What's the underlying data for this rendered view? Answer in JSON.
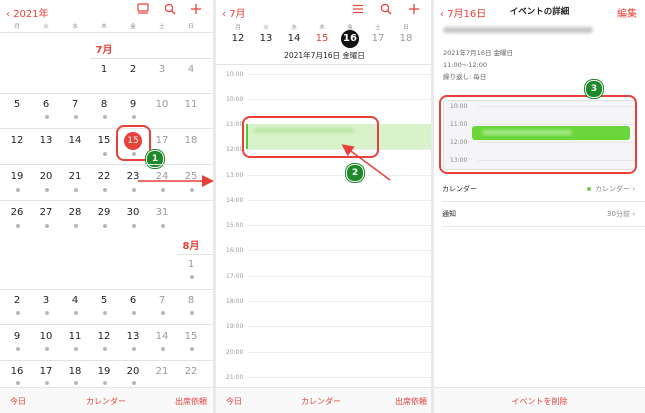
{
  "panel1": {
    "back_label": "2021年",
    "weekdays": [
      "月",
      "火",
      "水",
      "木",
      "金",
      "土",
      "日"
    ],
    "month_july": "7月",
    "month_aug": "8月",
    "days": {
      "r1": [
        "1",
        "2",
        "3",
        "4"
      ],
      "r2": [
        "5",
        "6",
        "7",
        "8",
        "9",
        "10",
        "11"
      ],
      "r3": [
        "12",
        "13",
        "14",
        "15",
        "15",
        "17",
        "18"
      ],
      "r4": [
        "19",
        "20",
        "21",
        "22",
        "23",
        "24",
        "25"
      ],
      "r5": [
        "26",
        "27",
        "28",
        "29",
        "30",
        "31"
      ],
      "a1": [
        "1"
      ],
      "a2": [
        "2",
        "3",
        "4",
        "5",
        "6",
        "7",
        "8"
      ],
      "a3": [
        "9",
        "10",
        "11",
        "12",
        "13",
        "14",
        "15"
      ],
      "a4": [
        "16",
        "17",
        "18",
        "19",
        "20",
        "21",
        "22"
      ]
    },
    "bottom": {
      "today": "今日",
      "calendar": "カレンダー",
      "invites": "出席依頼"
    }
  },
  "panel2": {
    "back_label": "7月",
    "weekdays": [
      "月",
      "火",
      "水",
      "木",
      "金",
      "土",
      "日"
    ],
    "week_days": [
      "12",
      "13",
      "14",
      "15",
      "16",
      "17",
      "18"
    ],
    "date_title": "2021年7月16日 金曜日",
    "times": [
      "10:00",
      "11:00",
      "12:00",
      "13:00",
      "14:00",
      "15:00",
      "16:00",
      "17:00",
      "18:00",
      "19:00",
      "20:00",
      "21:00"
    ],
    "bottom": {
      "today": "今日",
      "calendar": "カレンダー",
      "invites": "出席依頼"
    }
  },
  "panel3": {
    "back_label": "7月16日",
    "title": "イベントの詳細",
    "edit_label": "編集",
    "date_line": "2021年7月16日 金曜日",
    "time_line": "11:00〜12:00",
    "repeat_line": "繰り返し: 毎日",
    "mini_times": [
      "10:00",
      "11:00",
      "12:00",
      "13:00"
    ],
    "calendar_label": "カレンダー",
    "calendar_value": "カレンダー",
    "notify_label": "通知",
    "notify_value": "30分前",
    "delete_label": "イベントを削除"
  },
  "annotations": {
    "step1": "1",
    "step2": "2",
    "step3": "3"
  },
  "colors": {
    "accent": "#e8413a",
    "event_green": "#6ad63a",
    "badge_green": "#1f8a2a"
  }
}
